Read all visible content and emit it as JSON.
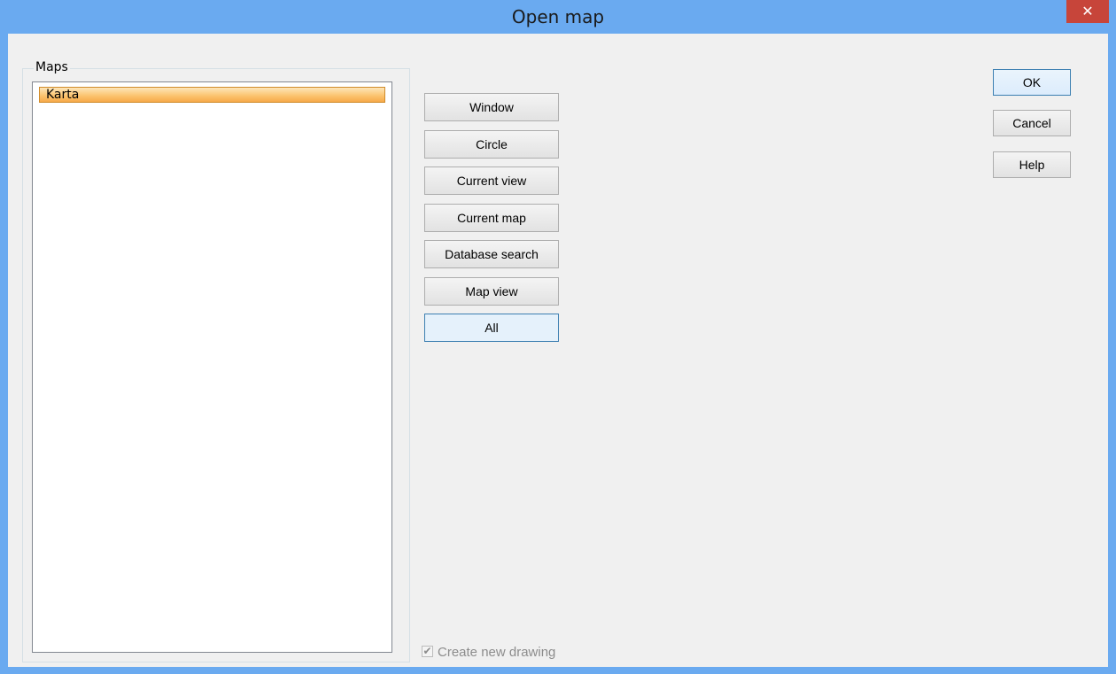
{
  "window": {
    "title": "Open map",
    "close_glyph": "✕"
  },
  "maps_group": {
    "label": "Maps",
    "items": [
      {
        "label": "Karta",
        "selected": true
      }
    ]
  },
  "filter_buttons": [
    {
      "label": "Window"
    },
    {
      "label": "Circle"
    },
    {
      "label": "Current view"
    },
    {
      "label": "Current map"
    },
    {
      "label": "Database search"
    },
    {
      "label": "Map view"
    },
    {
      "label": "All"
    }
  ],
  "dialog_buttons": {
    "ok": "OK",
    "cancel": "Cancel",
    "help": "Help"
  },
  "create_new_drawing": {
    "label": "Create new drawing",
    "checked": true,
    "enabled": false,
    "check_glyph": "✔"
  },
  "colors": {
    "titlebar": "#6aaaf0",
    "close_button": "#c7453a",
    "selection": "#fbc26c"
  }
}
